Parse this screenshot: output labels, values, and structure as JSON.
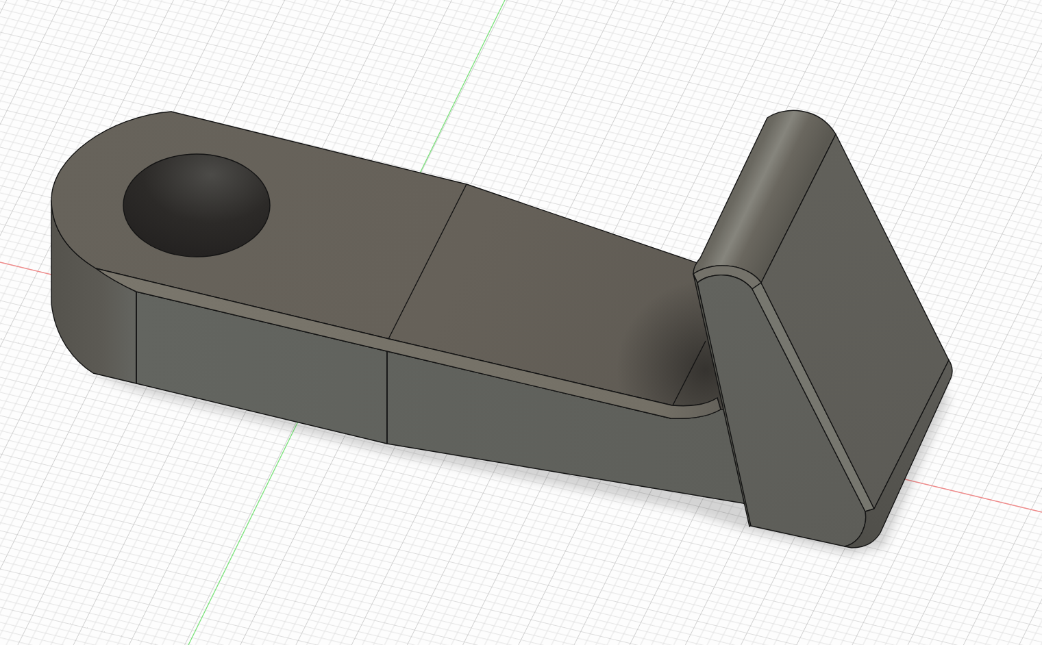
{
  "viewport": {
    "axes": [
      {
        "kind": "x",
        "color": "#f08a8a"
      },
      {
        "kind": "y",
        "color": "#7ae27a"
      }
    ]
  }
}
